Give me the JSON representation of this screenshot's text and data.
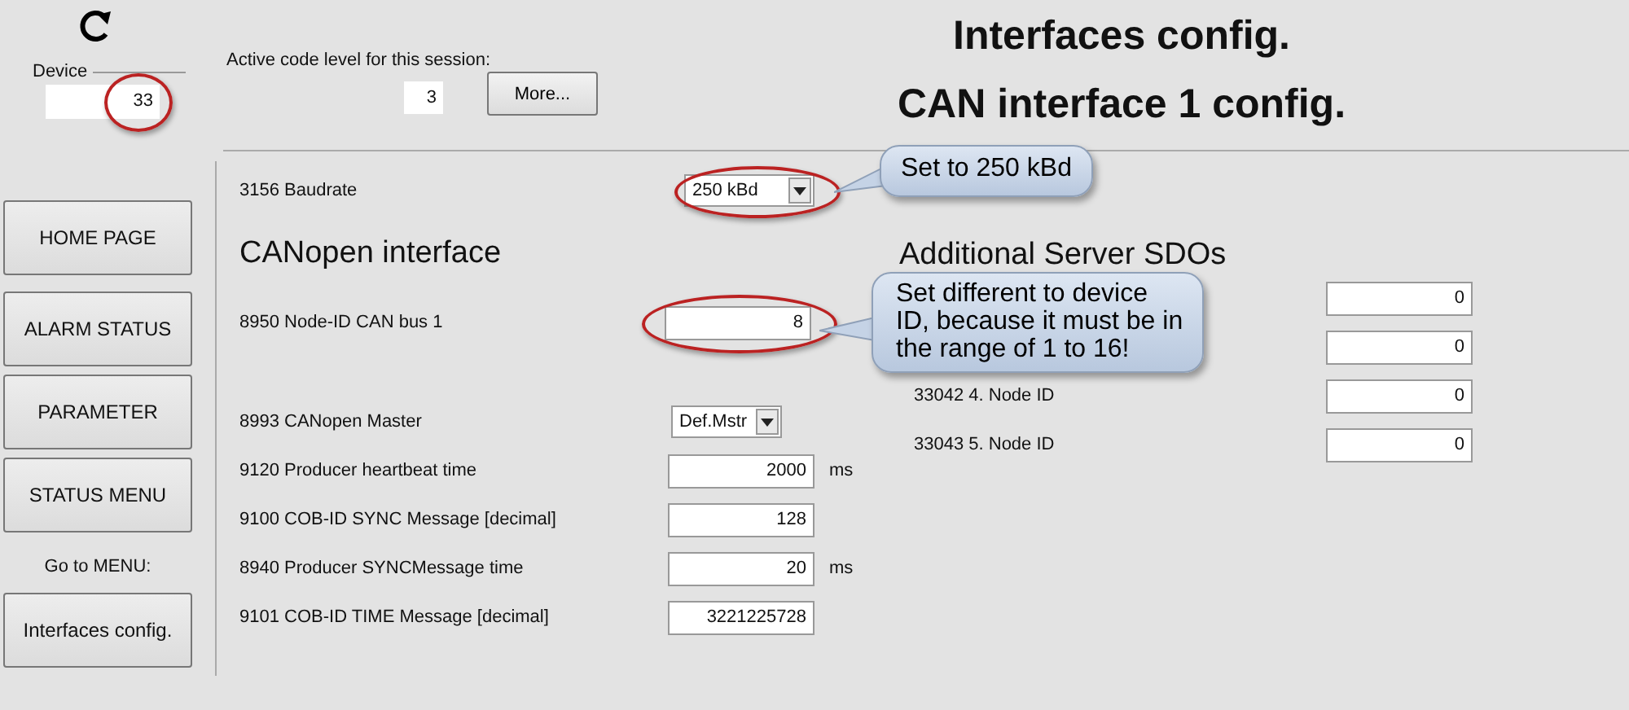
{
  "header": {
    "device": {
      "label": "Device",
      "value": "33",
      "highlighted": true
    },
    "code_level": {
      "label": "Active code level for this session:",
      "value": "3"
    },
    "more_button": "More...",
    "titles": [
      "Interfaces config.",
      "CAN interface 1 config."
    ]
  },
  "sidebar": {
    "buttons": [
      "HOME PAGE",
      "ALARM STATUS",
      "PARAMETER",
      "STATUS MENU"
    ],
    "goto_label": "Go to MENU:",
    "goto_button": "Interfaces config."
  },
  "baudrate": {
    "label": "3156 Baudrate",
    "value": "250 kBd",
    "highlighted": true
  },
  "canopen": {
    "heading": "CANopen interface",
    "node_id": {
      "label": "8950 Node-ID CAN bus 1",
      "value": "8",
      "highlighted": true
    },
    "params": [
      {
        "kind": "select",
        "label": "8993 CANopen Master",
        "value": "Def.Mstr"
      },
      {
        "kind": "input",
        "label": "9120 Producer heartbeat time",
        "value": "2000",
        "unit": "ms"
      },
      {
        "kind": "input",
        "label": "9100 COB-ID SYNC Message [decimal]",
        "value": "128"
      },
      {
        "kind": "input",
        "label": "8940 Producer SYNCMessage time",
        "value": "20",
        "unit": "ms"
      },
      {
        "kind": "input",
        "label": "9101 COB-ID TIME Message [decimal]",
        "value": "3221225728"
      }
    ]
  },
  "server_sdos": {
    "heading": "Additional Server SDOs",
    "rows": [
      {
        "value": "0"
      },
      {
        "value": "0"
      },
      {
        "label": "33042 4. Node ID",
        "value": "0"
      },
      {
        "label": "33043 5. Node ID",
        "value": "0"
      }
    ]
  },
  "callouts": [
    "Set to 250 kBd",
    "Set different to device ID, because it must be in the range of 1 to 16!"
  ]
}
